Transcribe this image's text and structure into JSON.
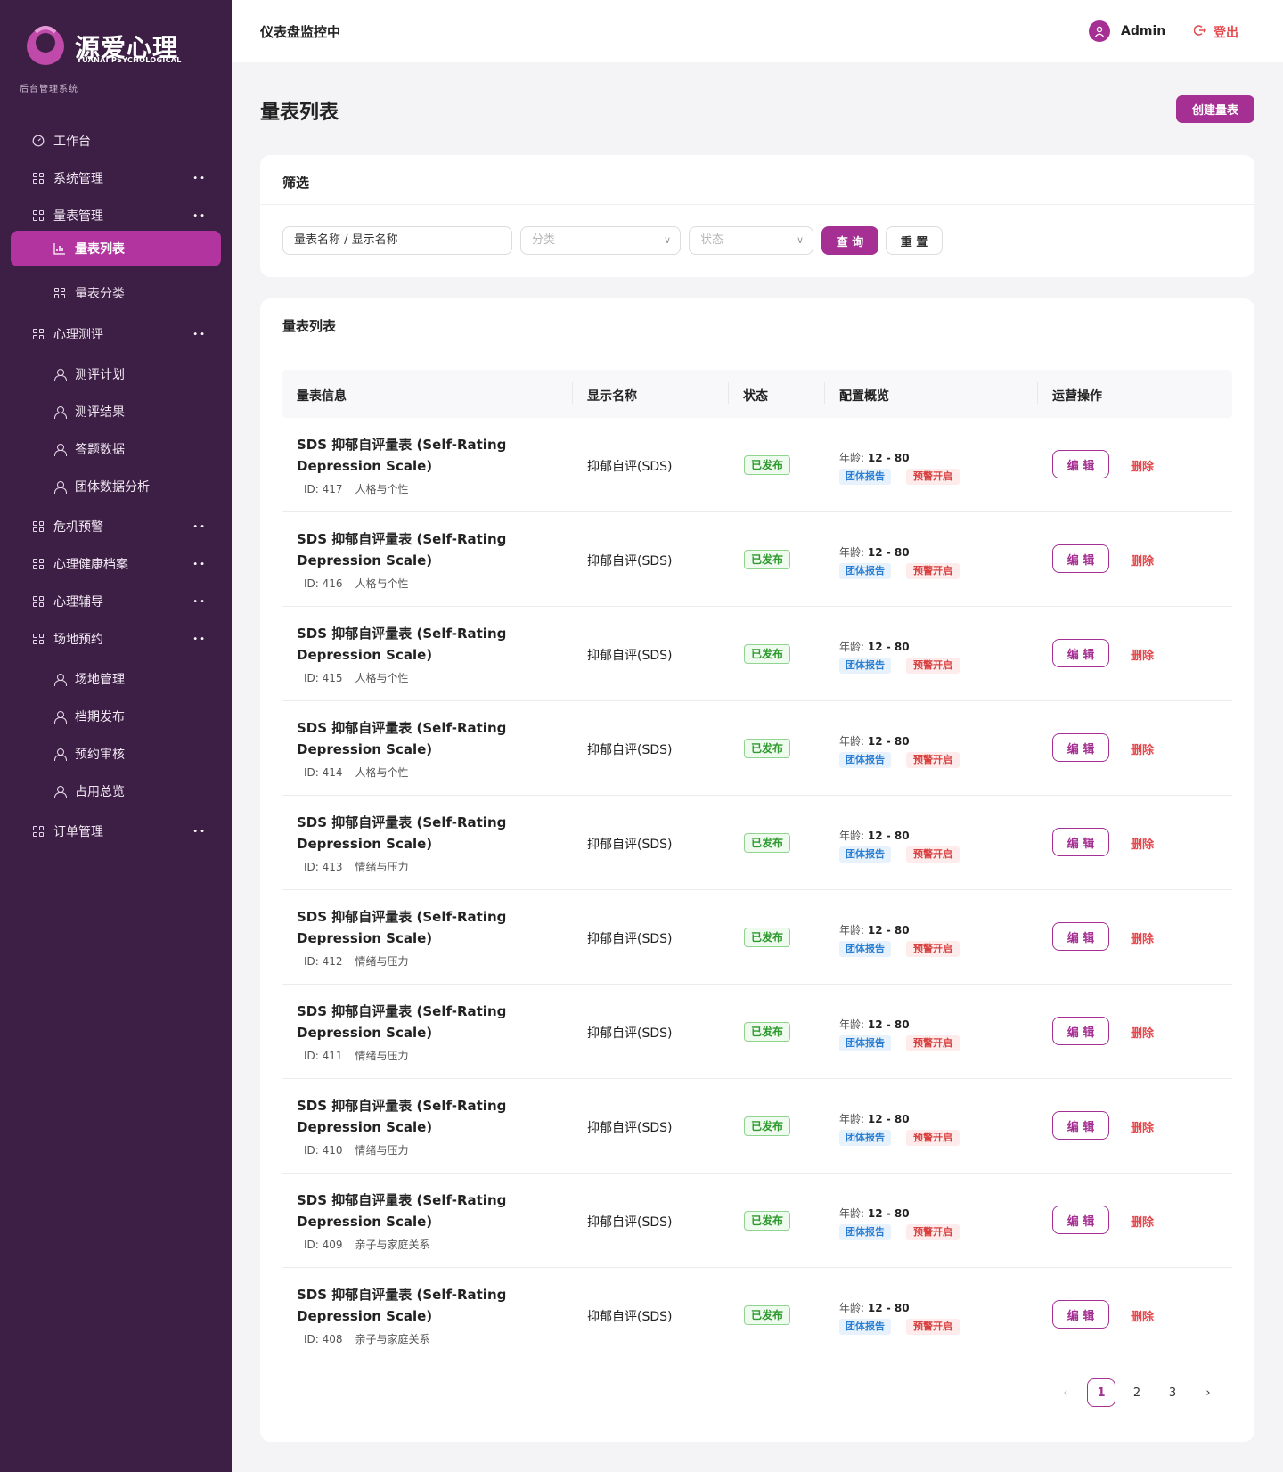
{
  "brand": {
    "logo_text": "源爱心理",
    "logo_sub": "YUANAI PSYCHOLOGICAL",
    "caption": "后台管理系统"
  },
  "sidebar": {
    "items": [
      {
        "label": "工作台",
        "icon": "dashboard-icon",
        "level": 1
      },
      {
        "label": "系统管理",
        "icon": "grid-icon",
        "level": 1,
        "dots": "••"
      },
      {
        "label": "量表管理",
        "icon": "grid-icon",
        "level": 1,
        "dots": "••"
      },
      {
        "label": "量表列表",
        "icon": "chart-icon",
        "level": 2,
        "active": true
      },
      {
        "label": "量表分类",
        "icon": "grid-icon",
        "level": 2
      },
      {
        "label": "心理测评",
        "icon": "grid-icon",
        "level": 1,
        "dots": "••"
      },
      {
        "label": "测评计划",
        "icon": "user-icon",
        "level": 2
      },
      {
        "label": "测评结果",
        "icon": "user-icon",
        "level": 2
      },
      {
        "label": "答题数据",
        "icon": "user-icon",
        "level": 2
      },
      {
        "label": "团体数据分析",
        "icon": "user-icon",
        "level": 2
      },
      {
        "label": "危机预警",
        "icon": "grid-icon",
        "level": 1,
        "dots": "••"
      },
      {
        "label": "心理健康档案",
        "icon": "grid-icon",
        "level": 1,
        "dots": "••"
      },
      {
        "label": "心理辅导",
        "icon": "grid-icon",
        "level": 1,
        "dots": "••"
      },
      {
        "label": "场地预约",
        "icon": "grid-icon",
        "level": 1,
        "dots": "••"
      },
      {
        "label": "场地管理",
        "icon": "user-icon",
        "level": 2
      },
      {
        "label": "档期发布",
        "icon": "user-icon",
        "level": 2
      },
      {
        "label": "预约审核",
        "icon": "user-icon",
        "level": 2
      },
      {
        "label": "占用总览",
        "icon": "user-icon",
        "level": 2
      },
      {
        "label": "订单管理",
        "icon": "grid-icon",
        "level": 1,
        "dots": "••"
      }
    ]
  },
  "header": {
    "title": "仪表盘监控中",
    "user": "Admin",
    "logout": "登出"
  },
  "main": {
    "page_title": "量表列表",
    "create_label": "创建量表"
  },
  "filter": {
    "heading": "筛选",
    "keyword_placeholder": "量表名称 / 显示名称",
    "category_placeholder": "分类",
    "status_placeholder": "状态",
    "query_label": "查 询",
    "reset_label": "重 置"
  },
  "list": {
    "heading": "量表列表",
    "columns": [
      "量表信息",
      "显示名称",
      "状态",
      "配置概览",
      "运营操作"
    ],
    "rows": [
      {
        "title": "SDS 抑郁自评量表 (Self-Rating Depression Scale)",
        "id": "ID: 417",
        "category": "人格与个性",
        "display": "抑郁自评(SDS)",
        "status": "已发布",
        "age_label": "年龄:",
        "age": "12 - 80",
        "tag1": "团体报告",
        "tag2": "预警开启",
        "edit": "编 辑",
        "delete": "删除"
      },
      {
        "title": "SDS 抑郁自评量表 (Self-Rating Depression Scale)",
        "id": "ID: 416",
        "category": "人格与个性",
        "display": "抑郁自评(SDS)",
        "status": "已发布",
        "age_label": "年龄:",
        "age": "12 - 80",
        "tag1": "团体报告",
        "tag2": "预警开启",
        "edit": "编 辑",
        "delete": "删除"
      },
      {
        "title": "SDS 抑郁自评量表 (Self-Rating Depression Scale)",
        "id": "ID: 415",
        "category": "人格与个性",
        "display": "抑郁自评(SDS)",
        "status": "已发布",
        "age_label": "年龄:",
        "age": "12 - 80",
        "tag1": "团体报告",
        "tag2": "预警开启",
        "edit": "编 辑",
        "delete": "删除"
      },
      {
        "title": "SDS 抑郁自评量表 (Self-Rating Depression Scale)",
        "id": "ID: 414",
        "category": "人格与个性",
        "display": "抑郁自评(SDS)",
        "status": "已发布",
        "age_label": "年龄:",
        "age": "12 - 80",
        "tag1": "团体报告",
        "tag2": "预警开启",
        "edit": "编 辑",
        "delete": "删除"
      },
      {
        "title": "SDS 抑郁自评量表 (Self-Rating Depression Scale)",
        "id": "ID: 413",
        "category": "情绪与压力",
        "display": "抑郁自评(SDS)",
        "status": "已发布",
        "age_label": "年龄:",
        "age": "12 - 80",
        "tag1": "团体报告",
        "tag2": "预警开启",
        "edit": "编 辑",
        "delete": "删除"
      },
      {
        "title": "SDS 抑郁自评量表 (Self-Rating Depression Scale)",
        "id": "ID: 412",
        "category": "情绪与压力",
        "display": "抑郁自评(SDS)",
        "status": "已发布",
        "age_label": "年龄:",
        "age": "12 - 80",
        "tag1": "团体报告",
        "tag2": "预警开启",
        "edit": "编 辑",
        "delete": "删除"
      },
      {
        "title": "SDS 抑郁自评量表 (Self-Rating Depression Scale)",
        "id": "ID: 411",
        "category": "情绪与压力",
        "display": "抑郁自评(SDS)",
        "status": "已发布",
        "age_label": "年龄:",
        "age": "12 - 80",
        "tag1": "团体报告",
        "tag2": "预警开启",
        "edit": "编 辑",
        "delete": "删除"
      },
      {
        "title": "SDS 抑郁自评量表 (Self-Rating Depression Scale)",
        "id": "ID: 410",
        "category": "情绪与压力",
        "display": "抑郁自评(SDS)",
        "status": "已发布",
        "age_label": "年龄:",
        "age": "12 - 80",
        "tag1": "团体报告",
        "tag2": "预警开启",
        "edit": "编 辑",
        "delete": "删除"
      },
      {
        "title": "SDS 抑郁自评量表 (Self-Rating Depression Scale)",
        "id": "ID: 409",
        "category": "亲子与家庭关系",
        "display": "抑郁自评(SDS)",
        "status": "已发布",
        "age_label": "年龄:",
        "age": "12 - 80",
        "tag1": "团体报告",
        "tag2": "预警开启",
        "edit": "编 辑",
        "delete": "删除"
      },
      {
        "title": "SDS 抑郁自评量表 (Self-Rating Depression Scale)",
        "id": "ID: 408",
        "category": "亲子与家庭关系",
        "display": "抑郁自评(SDS)",
        "status": "已发布",
        "age_label": "年龄:",
        "age": "12 - 80",
        "tag1": "团体报告",
        "tag2": "预警开启",
        "edit": "编 辑",
        "delete": "删除"
      }
    ]
  },
  "pagination": {
    "prev": "‹",
    "pages": [
      "1",
      "2",
      "3"
    ],
    "current": "1",
    "next": "›"
  },
  "colors": {
    "sidebar_bg": "#3d1f45",
    "accent": "#a52f92",
    "active_nav": "#b2359f",
    "danger": "#e5484d",
    "success": "#2f9a2f"
  }
}
